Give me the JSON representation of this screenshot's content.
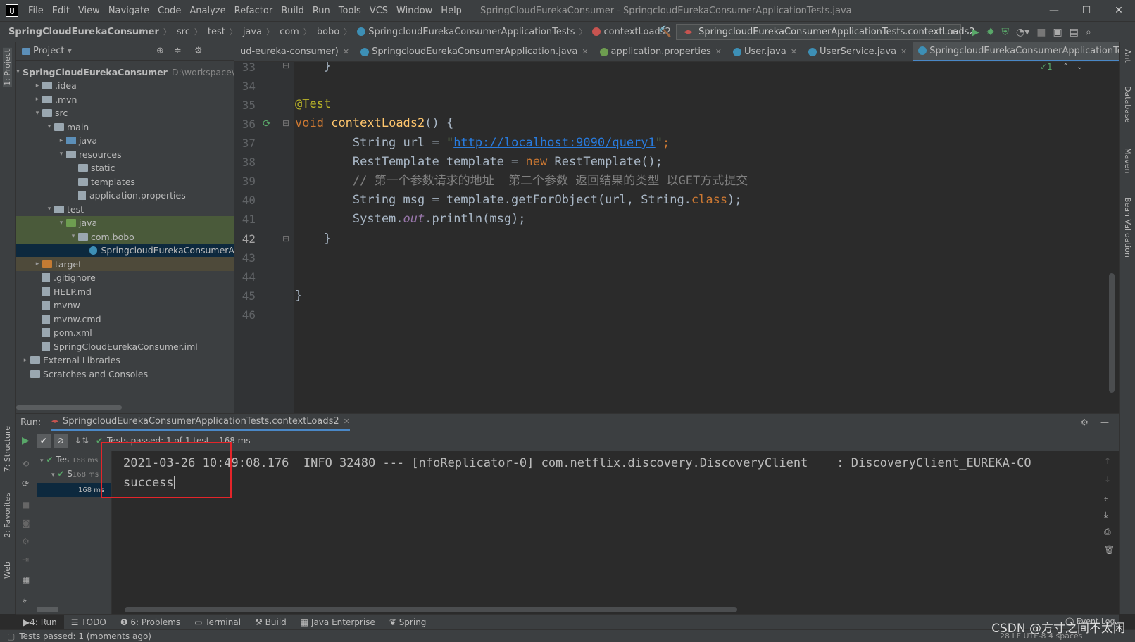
{
  "title": {
    "menu": [
      "File",
      "Edit",
      "View",
      "Navigate",
      "Code",
      "Analyze",
      "Refactor",
      "Build",
      "Run",
      "Tools",
      "VCS",
      "Window",
      "Help"
    ],
    "window_title": "SpringCloudEurekaConsumer - SpringcloudEurekaConsumerApplicationTests.java"
  },
  "breadcrumbs": [
    "SpringCloudEurekaConsumer",
    "src",
    "test",
    "java",
    "com",
    "bobo",
    "SpringcloudEurekaConsumerApplicationTests",
    "contextLoads2"
  ],
  "run_config": "SpringcloudEurekaConsumerApplicationTests.contextLoads2",
  "project": {
    "header": "Project",
    "tree": [
      {
        "label": "SpringCloudEurekaConsumer",
        "hint": "D:\\workspace\\",
        "depth": 0,
        "arrow": "▾",
        "type": "module"
      },
      {
        "label": ".idea",
        "depth": 1,
        "arrow": "▸",
        "type": "folder"
      },
      {
        "label": ".mvn",
        "depth": 1,
        "arrow": "▸",
        "type": "folder"
      },
      {
        "label": "src",
        "depth": 1,
        "arrow": "▾",
        "type": "folder"
      },
      {
        "label": "main",
        "depth": 2,
        "arrow": "▾",
        "type": "folder"
      },
      {
        "label": "java",
        "depth": 3,
        "arrow": "▸",
        "type": "blue"
      },
      {
        "label": "resources",
        "depth": 3,
        "arrow": "▾",
        "type": "folder"
      },
      {
        "label": "static",
        "depth": 4,
        "arrow": "",
        "type": "folder"
      },
      {
        "label": "templates",
        "depth": 4,
        "arrow": "",
        "type": "folder"
      },
      {
        "label": "application.properties",
        "depth": 4,
        "arrow": "",
        "type": "file"
      },
      {
        "label": "test",
        "depth": 2,
        "arrow": "▾",
        "type": "folder"
      },
      {
        "label": "java",
        "depth": 3,
        "arrow": "▾",
        "type": "green",
        "state": "hl"
      },
      {
        "label": "com.bobo",
        "depth": 4,
        "arrow": "▾",
        "type": "folder",
        "state": "hl"
      },
      {
        "label": "SpringcloudEurekaConsumerA",
        "depth": 5,
        "arrow": "",
        "type": "class",
        "state": "sel"
      },
      {
        "label": "target",
        "depth": 1,
        "arrow": "▸",
        "type": "orange",
        "state": "hl2"
      },
      {
        "label": ".gitignore",
        "depth": 1,
        "arrow": "",
        "type": "file"
      },
      {
        "label": "HELP.md",
        "depth": 1,
        "arrow": "",
        "type": "file"
      },
      {
        "label": "mvnw",
        "depth": 1,
        "arrow": "",
        "type": "file"
      },
      {
        "label": "mvnw.cmd",
        "depth": 1,
        "arrow": "",
        "type": "file"
      },
      {
        "label": "pom.xml",
        "depth": 1,
        "arrow": "",
        "type": "file"
      },
      {
        "label": "SpringCloudEurekaConsumer.iml",
        "depth": 1,
        "arrow": "",
        "type": "file"
      },
      {
        "label": "External Libraries",
        "depth": 0,
        "arrow": "▸",
        "type": "lib"
      },
      {
        "label": "Scratches and Consoles",
        "depth": 0,
        "arrow": "",
        "type": "lib"
      }
    ]
  },
  "tabs": [
    {
      "label": "ud-eureka-consumer)",
      "active": false
    },
    {
      "label": "SpringcloudEurekaConsumerApplication.java",
      "active": false
    },
    {
      "label": "application.properties",
      "active": false
    },
    {
      "label": "User.java",
      "active": false
    },
    {
      "label": "UserService.java",
      "active": false
    },
    {
      "label": "SpringcloudEurekaConsumerApplicationTests.java",
      "active": true
    }
  ],
  "editor": {
    "line_numbers": [
      "33",
      "34",
      "35",
      "36",
      "37",
      "38",
      "39",
      "40",
      "41",
      "42",
      "43",
      "44",
      "45",
      "46"
    ],
    "inspection": "✓1",
    "code": {
      "l33": "    }",
      "l35_annot": "@Test",
      "l36_kw": "void",
      "l36_fn": "contextLoads2",
      "l36_rest": "() {",
      "l37_pre": "        String url = ",
      "l37_q1": "\"",
      "l37_url": "http://localhost:9090/query1",
      "l37_q2": "\"",
      "l37_post": ";",
      "l38_pre": "        RestTemplate template = ",
      "l38_kw": "new",
      "l38_post": " RestTemplate();",
      "l39": "        // 第一个参数请求的地址  第二个参数 返回结果的类型 以GET方式提交",
      "l40_pre": "        String msg = template.getForObject(url, String.",
      "l40_kw": "class",
      "l40_post": ");",
      "l41_pre": "        System.",
      "l41_it": "out",
      "l41_post": ".println(msg);",
      "l42": "    }",
      "l45": "}"
    }
  },
  "run": {
    "label": "Run:",
    "tab": "SpringcloudEurekaConsumerApplicationTests.contextLoads2",
    "status": "Tests passed: 1 of 1 test – 168 ms",
    "tree": [
      {
        "label": "Tes",
        "time": "168 ms"
      },
      {
        "label": "S",
        "time": "168 ms"
      },
      {
        "label": "",
        "time": "168 ms"
      }
    ],
    "console": [
      "2021-03-26 10:49:08.176  INFO 32480 --- [nfoReplicator-0] com.netflix.discovery.DiscoveryClient    : DiscoveryClient_EUREKA-CO",
      "success"
    ]
  },
  "bottom_tabs": [
    "4: Run",
    "TODO",
    "6: Problems",
    "Terminal",
    "Build",
    "Java Enterprise",
    "Spring"
  ],
  "event_log": "Event Log",
  "status_bar": "Tests passed: 1 (moments ago)",
  "status_right": "28   LF   UTF-8   4 spaces",
  "watermark": "CSDN @方寸之间不太闲",
  "side_tabs_left": [
    "1: Project",
    "7: Structure",
    "2: Favorites",
    "Web"
  ],
  "side_tabs_right": [
    "Ant",
    "Database",
    "Maven",
    "Bean Validation"
  ]
}
